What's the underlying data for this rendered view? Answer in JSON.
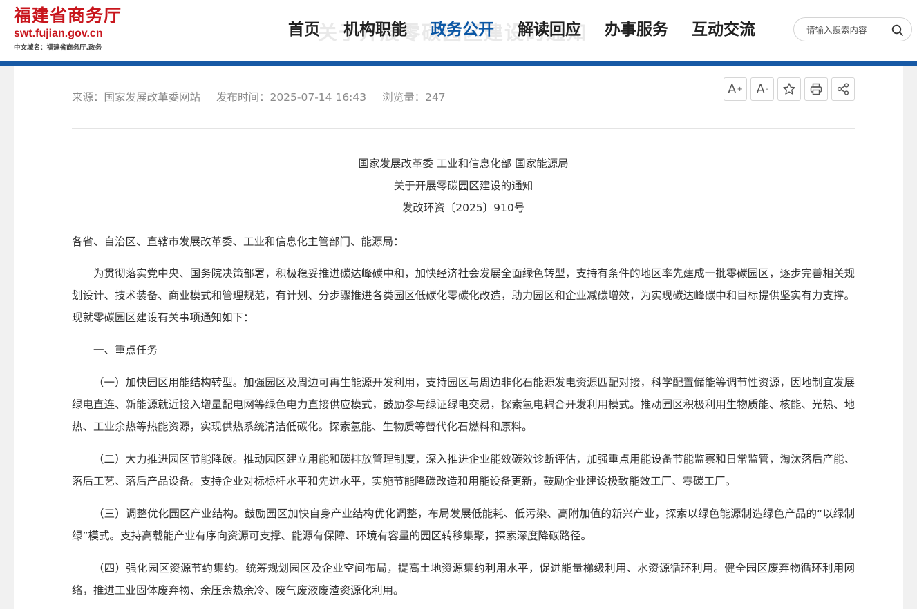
{
  "site": {
    "name_cn": "福建省商务厅",
    "domain_en": "swt.fujian.gov.cn",
    "domain_cn": "中文域名：福建省商务厅.政务"
  },
  "ghost_title": "关于开展零碳园区建设的通知",
  "nav": {
    "items": [
      {
        "label": "首页"
      },
      {
        "label": "机构职能"
      },
      {
        "label": "政务公开"
      },
      {
        "label": "解读回应"
      },
      {
        "label": "办事服务"
      },
      {
        "label": "互动交流"
      }
    ],
    "active_index": 2
  },
  "search": {
    "placeholder": "请输入搜索内容",
    "icon": "search-icon"
  },
  "meta": {
    "source": "来源：国家发展改革委网站",
    "publish_time": "发布时间：2025-07-14 16:43",
    "views": "浏览量：247"
  },
  "tools": {
    "font_increase": "A",
    "font_increase_sup": "+",
    "font_decrease": "A",
    "font_decrease_sup": "-",
    "icons": [
      "star-icon",
      "print-icon",
      "share-icon"
    ]
  },
  "document": {
    "issuer": "国家发展改革委 工业和信息化部 国家能源局",
    "title": "关于开展零碳园区建设的通知",
    "number": "发改环资〔2025〕910号",
    "salutation": "各省、自治区、直辖市发展改革委、工业和信息化主管部门、能源局：",
    "paragraphs": [
      "为贯彻落实党中央、国务院决策部署，积极稳妥推进碳达峰碳中和，加快经济社会发展全面绿色转型，支持有条件的地区率先建成一批零碳园区，逐步完善相关规划设计、技术装备、商业模式和管理规范，有计划、分步骤推进各类园区低碳化零碳化改造，助力园区和企业减碳增效，为实现碳达峰碳中和目标提供坚实有力支撑。现就零碳园区建设有关事项通知如下：",
      "一、重点任务",
      "（一）加快园区用能结构转型。加强园区及周边可再生能源开发利用，支持园区与周边非化石能源发电资源匹配对接，科学配置储能等调节性资源，因地制宜发展绿电直连、新能源就近接入增量配电网等绿色电力直接供应模式，鼓励参与绿证绿电交易，探索氢电耦合开发利用模式。推动园区积极利用生物质能、核能、光热、地热、工业余热等热能资源，实现供热系统清洁低碳化。探索氢能、生物质等替代化石燃料和原料。",
      "（二）大力推进园区节能降碳。推动园区建立用能和碳排放管理制度，深入推进企业能效碳效诊断评估，加强重点用能设备节能监察和日常监管，淘汰落后产能、落后工艺、落后产品设备。支持企业对标标杆水平和先进水平，实施节能降碳改造和用能设备更新，鼓励企业建设极致能效工厂、零碳工厂。",
      "（三）调整优化园区产业结构。鼓励园区加快自身产业结构优化调整，布局发展低能耗、低污染、高附加值的新兴产业，探索以绿色能源制造绿色产品的“以绿制绿”模式。支持高载能产业有序向资源可支撑、能源有保障、环境有容量的园区转移集聚，探索深度降碳路径。",
      "（四）强化园区资源节约集约。统筹规划园区及企业空间布局，提高土地资源集约利用水平，促进能量梯级利用、水资源循环利用。健全园区废弃物循环利用网络，推进工业固体废弃物、余压余热余冷、废气废液废渣资源化利用。"
    ]
  },
  "colors": {
    "brand_red": "#c8161d",
    "nav_active": "#0b57a5",
    "blue_bar": "#1759a5"
  }
}
